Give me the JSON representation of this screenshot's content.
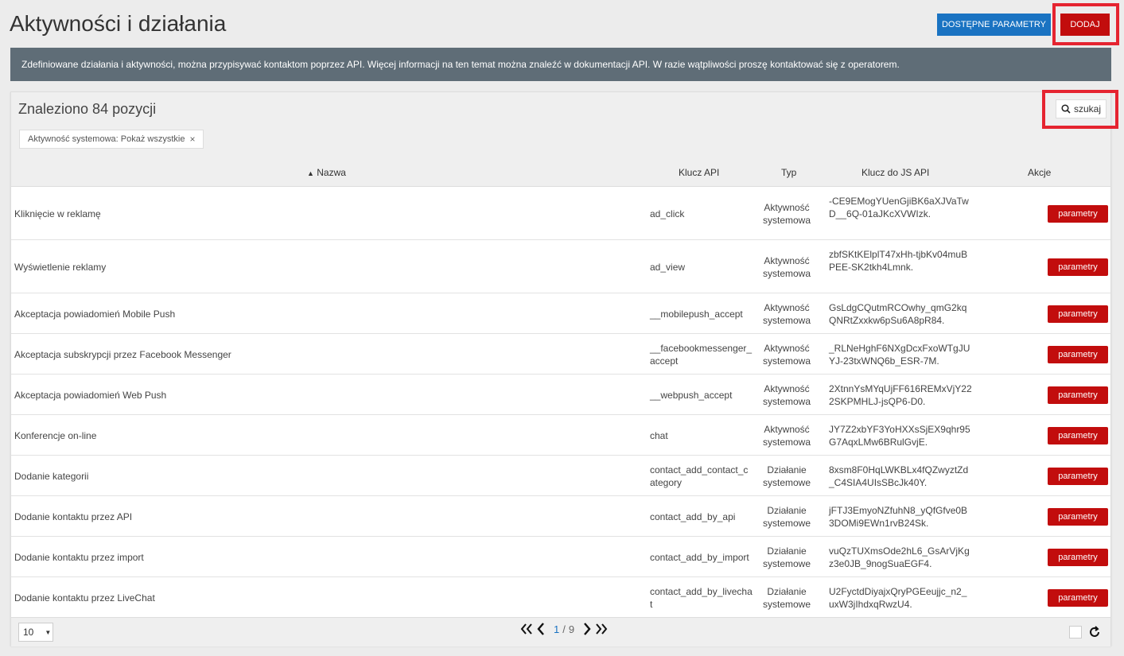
{
  "header": {
    "title": "Aktywności i działania",
    "params_button": "DOSTĘPNE PARAMETRY",
    "add_button": "DODAJ"
  },
  "info": "Zdefiniowane działania i aktywności, można przypisywać kontaktom poprzez API. Więcej informacji na ten temat można znaleźć w dokumentacji API. W razie wątpliwości proszę kontaktować się z operatorem.",
  "panel": {
    "found": "Znaleziono 84 pozycji",
    "search_label": "szukaj",
    "filter_chip": "Aktywność systemowa: Pokaż wszystkie",
    "columns": {
      "name": "Nazwa",
      "api_key": "Klucz API",
      "type": "Typ",
      "js_key": "Klucz do JS API",
      "actions": "Akcje"
    },
    "row_button": "parametry",
    "rows": [
      {
        "name": "Kliknięcie w reklamę",
        "key": "ad_click",
        "type": "Aktywność systemowa",
        "js": "-CE9EMogYUenGjiBK6aXJVaTwD__6Q-01aJKcXVWIzk."
      },
      {
        "name": "Wyświetlenie reklamy",
        "key": "ad_view",
        "type": "Aktywność systemowa",
        "js": "zbfSKtKElplT47xHh-tjbKv04muBPEE-SK2tkh4Lmnk."
      },
      {
        "name": "Akceptacja powiadomień Mobile Push",
        "key": "__mobilepush_accept",
        "type": "Aktywność systemowa",
        "js": "GsLdgCQutmRCOwhy_qmG2kqQNRtZxxkw6pSu6A8pR84."
      },
      {
        "name": "Akceptacja subskrypcji przez Facebook Messenger",
        "key": "__facebookmessenger_accept",
        "type": "Aktywność systemowa",
        "js": "_RLNeHghF6NXgDcxFxoWTgJUYJ-23txWNQ6b_ESR-7M."
      },
      {
        "name": "Akceptacja powiadomień Web Push",
        "key": "__webpush_accept",
        "type": "Aktywność systemowa",
        "js": "2XtnnYsMYqUjFF616REMxVjY222SKPMHLJ-jsQP6-D0."
      },
      {
        "name": "Konferencje on-line",
        "key": "chat",
        "type": "Aktywność systemowa",
        "js": "JY7Z2xbYF3YoHXXsSjEX9qhr95G7AqxLMw6BRulGvjE."
      },
      {
        "name": "Dodanie kategorii",
        "key": "contact_add_contact_category",
        "type": "Działanie systemowe",
        "js": "8xsm8F0HqLWKBLx4fQZwyztZd_C4SIA4UIsSBcJk40Y."
      },
      {
        "name": "Dodanie kontaktu przez API",
        "key": "contact_add_by_api",
        "type": "Działanie systemowe",
        "js": "jFTJ3EmyoNZfuhN8_yQfGfve0B3DOMi9EWn1rvB24Sk."
      },
      {
        "name": "Dodanie kontaktu przez import",
        "key": "contact_add_by_import",
        "type": "Działanie systemowe",
        "js": "vuQzTUXmsOde2hL6_GsArVjKgz3e0JB_9nogSuaEGF4."
      },
      {
        "name": "Dodanie kontaktu przez LiveChat",
        "key": "contact_add_by_livechat",
        "type": "Działanie systemowe",
        "js": "U2FyctdDiyajxQryPGEeujjc_n2_uxW3jIhdxqRwzU4."
      }
    ]
  },
  "footer": {
    "per_page": "10",
    "page": "1",
    "separator": "/",
    "total_pages": "9"
  }
}
